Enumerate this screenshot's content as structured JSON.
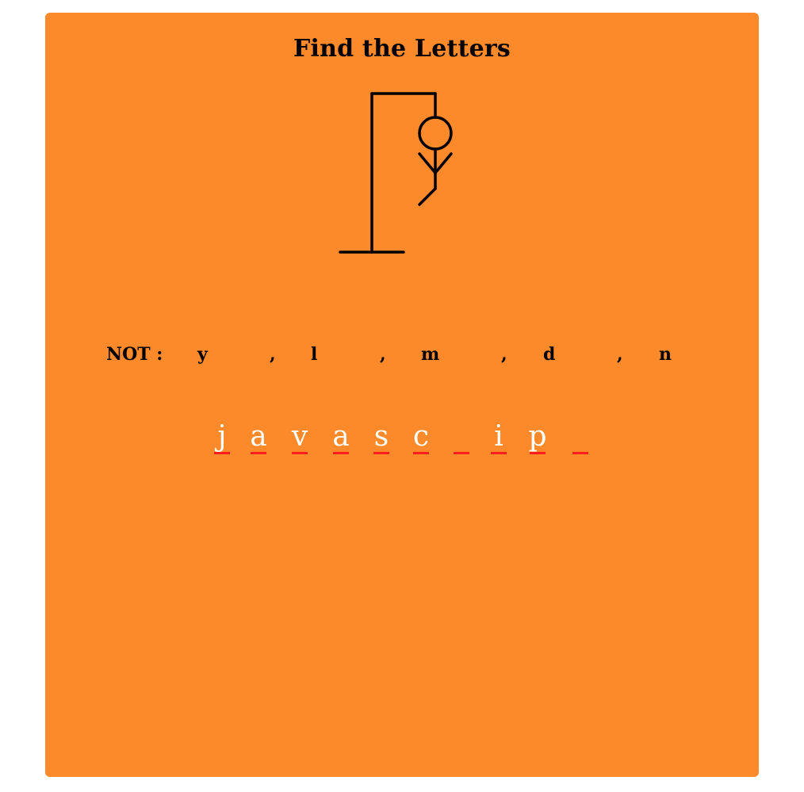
{
  "title": "Find the Letters",
  "not_label": "NOT :",
  "wrong_letters": [
    "y",
    "l",
    "m",
    "d",
    "n"
  ],
  "separator": ",",
  "word_slots": [
    "j",
    "a",
    "v",
    "a",
    "s",
    "c",
    "",
    "i",
    "p",
    ""
  ],
  "colors": {
    "card_background": "#fd8a2a",
    "revealed_letter": "#ffffff",
    "slot_underline": "#ff1e1e",
    "drawing": "#000000"
  },
  "hangman_parts_drawn": [
    "gallows",
    "head",
    "body",
    "left-arm",
    "right-arm",
    "left-leg"
  ]
}
